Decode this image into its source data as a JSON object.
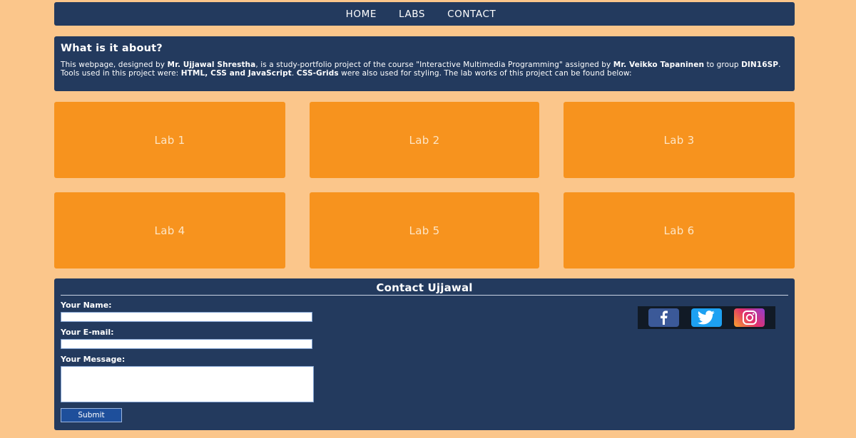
{
  "nav": {
    "items": [
      {
        "label": "HOME"
      },
      {
        "label": "LABS"
      },
      {
        "label": "CONTACT"
      }
    ]
  },
  "about": {
    "title": "What is it about?",
    "text": {
      "p1": "This webpage, designed by ",
      "author": "Mr. Ujjawal Shrestha",
      "p2": ", is a study-portfolio project of the course \"Interactive Multimedia Programming\" assigned by ",
      "teacher": "Mr. Veikko Tapaninen",
      "p3": " to group ",
      "group": "DIN16SP",
      "p4": ". Tools used in this project were: ",
      "tools": "HTML, CSS and JavaScript",
      "p5": ". ",
      "grids": "CSS-Grids",
      "p6": " were also used for styling. The lab works of this project can be found below:"
    }
  },
  "labs": [
    {
      "label": "Lab 1"
    },
    {
      "label": "Lab 2"
    },
    {
      "label": "Lab 3"
    },
    {
      "label": "Lab 4"
    },
    {
      "label": "Lab 5"
    },
    {
      "label": "Lab 6"
    }
  ],
  "contact": {
    "title": "Contact Ujjawal",
    "name_label": "Your Name:",
    "name_value": "",
    "email_label": "Your E-mail:",
    "email_value": "",
    "message_label": "Your Message:",
    "message_value": "",
    "submit_label": "Submit"
  },
  "social": {
    "icons": [
      "facebook-icon",
      "twitter-icon",
      "instagram-icon"
    ]
  },
  "colors": {
    "background": "#fbc68b",
    "panel": "#233a5e",
    "lab_tile": "#f7931e",
    "submit": "#1e4f9b"
  }
}
